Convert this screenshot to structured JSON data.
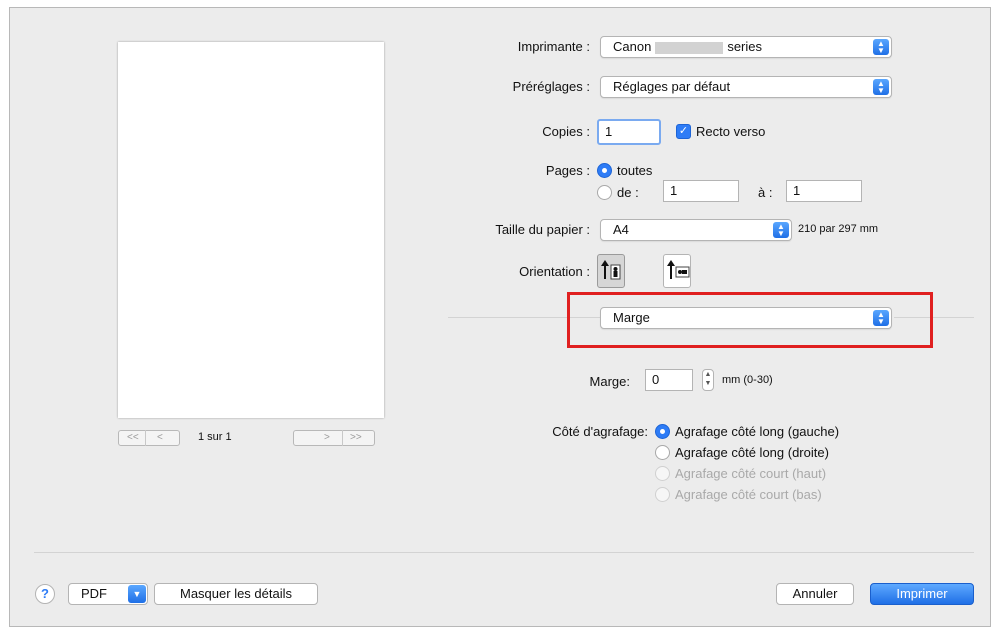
{
  "preview": {
    "page_indicator": "1 sur 1",
    "first_label": "<<",
    "prev_label": "<",
    "next_label": ">",
    "last_label": ">>"
  },
  "printer": {
    "label": "Imprimante :",
    "value_prefix": "Canon",
    "value_suffix": "series"
  },
  "presets": {
    "label": "Préréglages :",
    "value": "Réglages par défaut"
  },
  "copies": {
    "label": "Copies :",
    "value": "1",
    "duplex_label": "Recto verso",
    "duplex_checked": true
  },
  "pages": {
    "label": "Pages :",
    "all_label": "toutes",
    "from_label": "de :",
    "from_value": "1",
    "to_label": "à :",
    "to_value": "1",
    "selected": "toutes"
  },
  "paper_size": {
    "label": "Taille du papier :",
    "value": "A4",
    "dimensions": "210 par 297 mm"
  },
  "orientation": {
    "label": "Orientation :",
    "selected": "portrait",
    "icons": [
      "portrait-orientation-icon",
      "landscape-orientation-icon"
    ]
  },
  "section": {
    "value": "Marge",
    "highlight_color": "#e02020"
  },
  "margin": {
    "label": "Marge:",
    "value": "0",
    "range": "mm (0-30)"
  },
  "stapling": {
    "label": "Côté d'agrafage:",
    "options": [
      {
        "label": "Agrafage côté long (gauche)",
        "selected": true,
        "enabled": true
      },
      {
        "label": "Agrafage côté long (droite)",
        "selected": false,
        "enabled": true
      },
      {
        "label": "Agrafage côté court (haut)",
        "selected": false,
        "enabled": false
      },
      {
        "label": "Agrafage côté court (bas)",
        "selected": false,
        "enabled": false
      }
    ]
  },
  "footer": {
    "help_label": "?",
    "pdf_label": "PDF",
    "hide_details_label": "Masquer les détails",
    "cancel_label": "Annuler",
    "print_label": "Imprimer"
  },
  "colors": {
    "accent": "#2e7cf6",
    "dialog_bg": "#ececec"
  }
}
